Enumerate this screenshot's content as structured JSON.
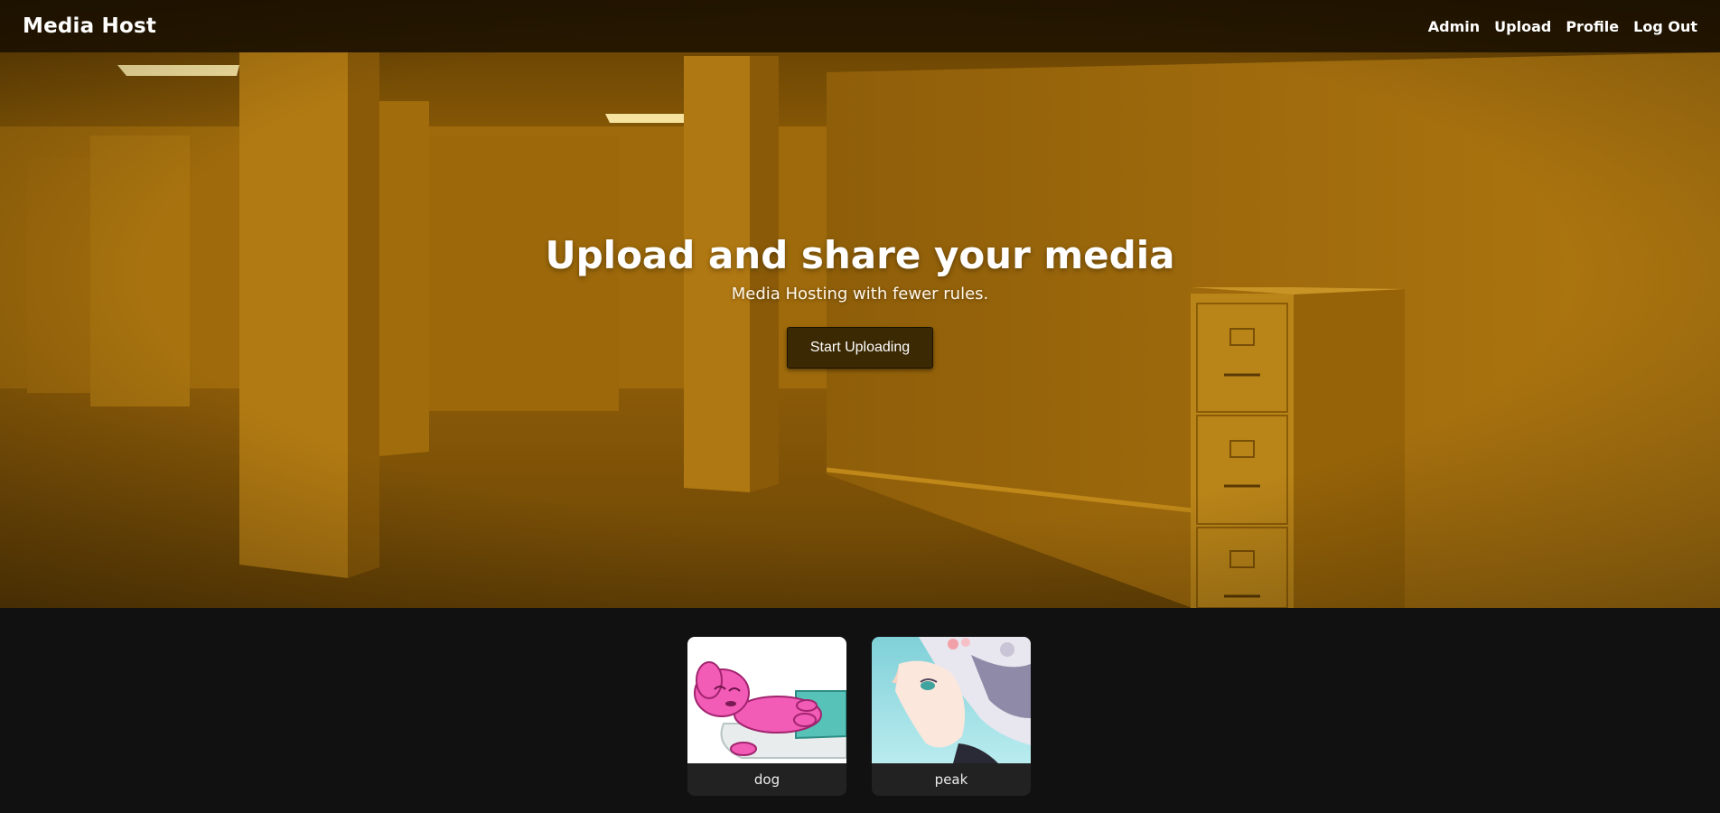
{
  "nav": {
    "brand": "Media Host",
    "links": [
      "Admin",
      "Upload",
      "Profile",
      "Log Out"
    ]
  },
  "hero": {
    "title": "Upload and share your media",
    "subtitle": "Media Hosting with fewer rules.",
    "cta_label": "Start Uploading"
  },
  "gallery": {
    "items": [
      {
        "label": "dog",
        "thumbnail": "pink-cartoon-dog-lying-down"
      },
      {
        "label": "peak",
        "thumbnail": "anime-girl-looking-up"
      }
    ]
  },
  "colors": {
    "hero_tint": "#9a6608",
    "navbar_bg": "#120a00",
    "page_bg": "#111111",
    "card_bg": "#222222",
    "button_bg": "#3b2904"
  }
}
